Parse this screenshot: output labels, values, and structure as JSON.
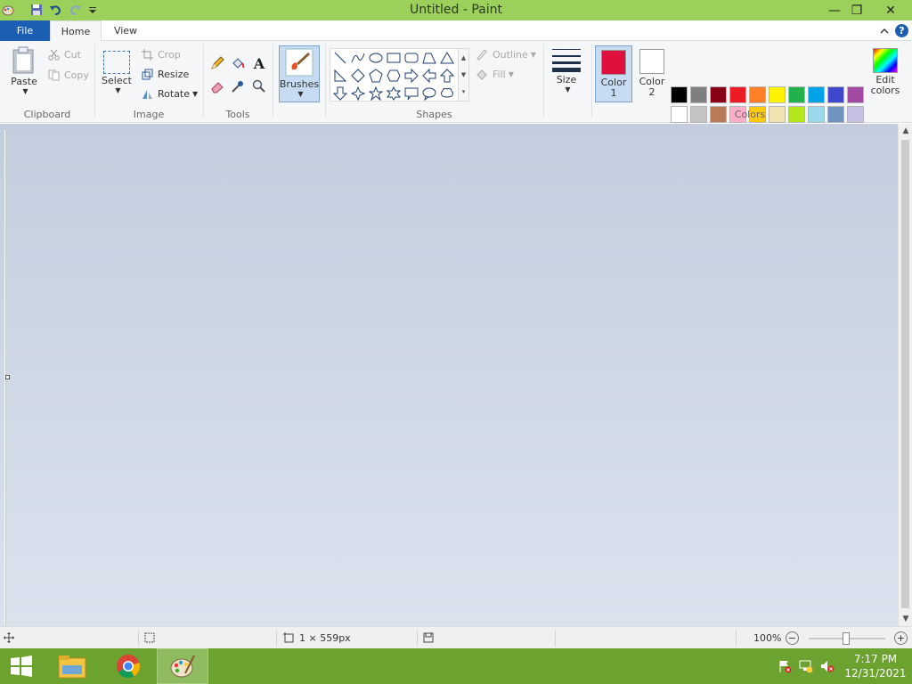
{
  "window": {
    "title": "Untitled - Paint",
    "minimize_glyph": "—",
    "restore_glyph": "❐",
    "close_glyph": "✕"
  },
  "tabs": {
    "file": "File",
    "home": "Home",
    "view": "View",
    "help": "?"
  },
  "clipboard": {
    "paste": "Paste",
    "cut": "Cut",
    "copy": "Copy",
    "group": "Clipboard"
  },
  "image": {
    "select": "Select",
    "crop": "Crop",
    "resize": "Resize",
    "rotate": "Rotate",
    "group": "Image"
  },
  "tools": {
    "group": "Tools",
    "text_glyph": "A"
  },
  "brushes": {
    "label": "Brushes"
  },
  "shapes": {
    "outline": "Outline",
    "fill": "Fill",
    "group": "Shapes"
  },
  "size": {
    "label": "Size"
  },
  "colors": {
    "color1_label": "Color 1",
    "color2_label": "Color 2",
    "color1_value": "#e0103c",
    "color2_value": "#ffffff",
    "edit_label": "Edit colors",
    "group": "Colors",
    "palette": [
      [
        "#000000",
        "#7f7f7f",
        "#880015",
        "#ed1c24",
        "#ff7f27",
        "#fff200",
        "#22b14c",
        "#00a2e8",
        "#3f48cc",
        "#a349a4"
      ],
      [
        "#ffffff",
        "#c3c3c3",
        "#b97a57",
        "#ffaec9",
        "#ffc90e",
        "#efe4b0",
        "#b5e61d",
        "#99d9ea",
        "#7092be",
        "#c8bfe7"
      ],
      [
        "#e0103c",
        "#f4f4f4",
        "#f4f4f4",
        "#f4f4f4",
        "#f4f4f4",
        "#f4f4f4",
        "#f4f4f4",
        "#f4f4f4",
        "#f4f4f4",
        "#f4f4f4"
      ]
    ]
  },
  "status": {
    "canvas_size": "1 × 559px",
    "zoom": "100%",
    "zoom_level": 1.0,
    "zoom_minus": "−",
    "zoom_plus": "+"
  },
  "taskbar": {
    "time": "7:17 PM",
    "date": "12/31/2021"
  }
}
